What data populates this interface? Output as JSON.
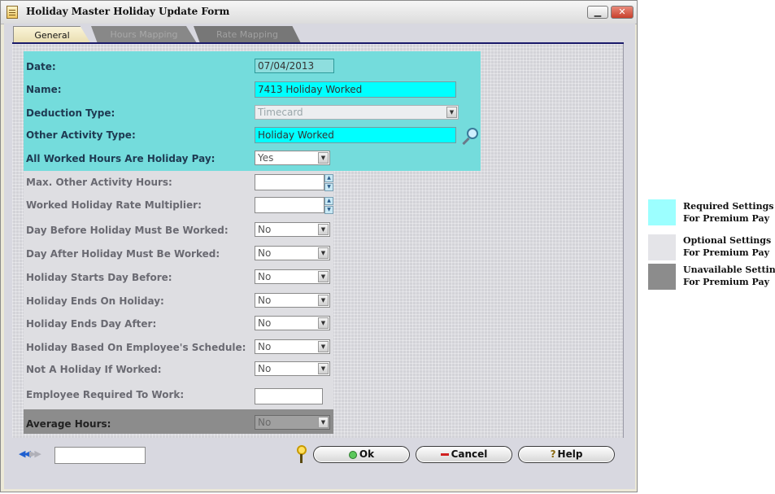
{
  "window": {
    "title": "Holiday Master Holiday Update Form"
  },
  "tabs": [
    {
      "label": "General"
    },
    {
      "label": "Hours Mapping"
    },
    {
      "label": "Rate Mapping"
    }
  ],
  "required": {
    "date": {
      "label": "Date:",
      "value": "07/04/2013"
    },
    "name": {
      "label": "Name:",
      "value": "7413 Holiday Worked"
    },
    "deduction_type": {
      "label": "Deduction Type:",
      "value": "Timecard"
    },
    "other_activity_type": {
      "label": "Other Activity Type:",
      "value": "Holiday Worked"
    },
    "all_worked_holiday_pay": {
      "label": "All Worked Hours Are Holiday Pay:",
      "value": "Yes"
    }
  },
  "optional": {
    "max_other_activity_hours": {
      "label": "Max. Other Activity Hours:",
      "value": ""
    },
    "worked_holiday_rate_multiplier": {
      "label": "Worked Holiday Rate Multiplier:",
      "value": ""
    },
    "day_before_worked": {
      "label": "Day Before Holiday Must Be Worked:",
      "value": "No"
    },
    "day_after_worked": {
      "label": "Day After Holiday Must Be Worked:",
      "value": "No"
    },
    "starts_day_before": {
      "label": "Holiday Starts Day Before:",
      "value": "No"
    },
    "ends_on_holiday": {
      "label": "Holiday Ends On Holiday:",
      "value": "No"
    },
    "ends_day_after": {
      "label": "Holiday Ends Day After:",
      "value": "No"
    },
    "based_on_schedule": {
      "label": "Holiday Based On Employee's Schedule:",
      "value": "No"
    },
    "not_holiday_if_worked": {
      "label": "Not A Holiday If Worked:",
      "value": "No"
    },
    "employee_required": {
      "label": "Employee Required To Work:",
      "value": ""
    }
  },
  "unavailable": {
    "average_hours": {
      "label": "Average Hours:",
      "value": "No"
    }
  },
  "legend": [
    {
      "line1": "Required Settings",
      "line2": "For Premium Pay",
      "color": "#9cffff"
    },
    {
      "line1": "Optional Settings",
      "line2": "For Premium Pay",
      "color": "#e4e4e8"
    },
    {
      "line1": "Unavailable Settings",
      "line2": "For Premium Pay",
      "color": "#8c8c8c"
    }
  ],
  "footer": {
    "ok_label": "Ok",
    "cancel_label": "Cancel",
    "help_label": "Help",
    "record_value": ""
  },
  "colors": {
    "required": "#74dcdc",
    "optional": "#dedee2",
    "unavailable": "#8c8c8c",
    "tab_border": "#1a1a6a"
  }
}
